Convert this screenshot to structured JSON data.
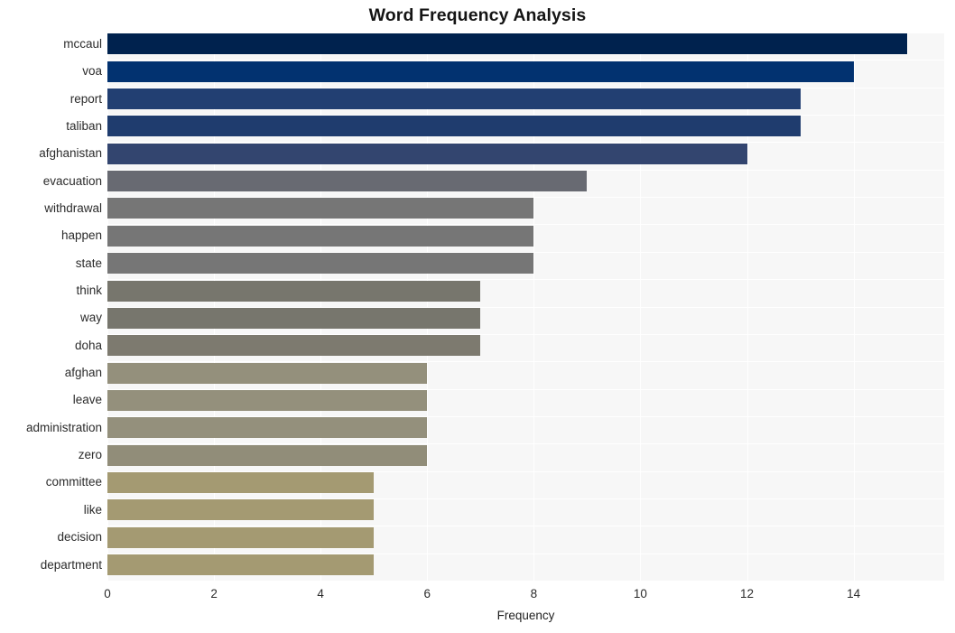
{
  "chart_data": {
    "type": "bar",
    "orientation": "horizontal",
    "title": "Word Frequency Analysis",
    "xlabel": "Frequency",
    "ylabel": "",
    "categories": [
      "mccaul",
      "voa",
      "report",
      "taliban",
      "afghanistan",
      "evacuation",
      "withdrawal",
      "happen",
      "state",
      "think",
      "way",
      "doha",
      "afghan",
      "leave",
      "administration",
      "zero",
      "committee",
      "like",
      "decision",
      "department"
    ],
    "values": [
      15,
      14,
      13,
      13,
      12,
      9,
      8,
      8,
      8,
      7,
      7,
      7,
      6,
      6,
      6,
      6,
      5,
      5,
      5,
      5
    ],
    "bar_colors": [
      "#00224e",
      "#023270",
      "#223f72",
      "#1f3c6e",
      "#33456f",
      "#686a72",
      "#767676",
      "#767676",
      "#767676",
      "#77766d",
      "#77766d",
      "#7d7a6f",
      "#94907c",
      "#94907c",
      "#94907c",
      "#918d79",
      "#a49a72",
      "#a49a72",
      "#a49a72",
      "#a49a72"
    ],
    "xticks": [
      0,
      2,
      4,
      6,
      8,
      10,
      12,
      14
    ],
    "xlim": [
      0,
      15.7
    ],
    "grid": true,
    "grid_color": "#ffffff",
    "plot_background": "#f7f7f7",
    "figure_background": "#ffffff",
    "legend": null,
    "annotations": []
  },
  "axis": {
    "x_tick_labels": [
      "0",
      "2",
      "4",
      "6",
      "8",
      "10",
      "12",
      "14"
    ],
    "y_tick_labels": [
      "mccaul",
      "voa",
      "report",
      "taliban",
      "afghanistan",
      "evacuation",
      "withdrawal",
      "happen",
      "state",
      "think",
      "way",
      "doha",
      "afghan",
      "leave",
      "administration",
      "zero",
      "committee",
      "like",
      "decision",
      "department"
    ]
  }
}
